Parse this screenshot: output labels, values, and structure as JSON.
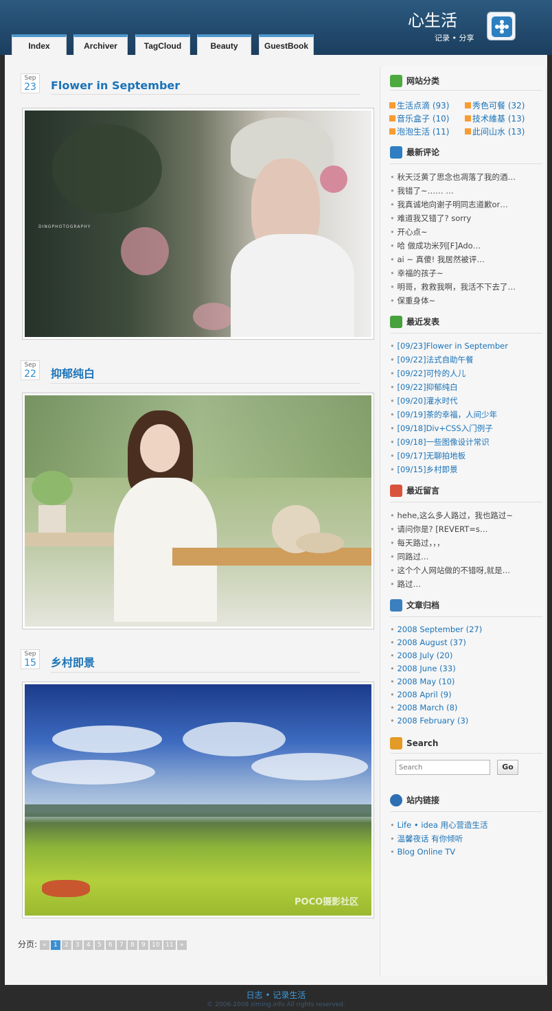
{
  "site": {
    "title": "心生活",
    "subtitle": "记录 • 分享"
  },
  "nav": {
    "tabs": [
      "Index",
      "Archiver",
      "TagCloud",
      "Beauty",
      "GuestBook"
    ]
  },
  "posts": [
    {
      "month": "Sep",
      "day": "23",
      "title": "Flower in September"
    },
    {
      "month": "Sep",
      "day": "22",
      "title": "抑郁纯白"
    },
    {
      "month": "Sep",
      "day": "15",
      "title": "乡村即景"
    }
  ],
  "photo_texts": {
    "p1_watermark": "DINGPHOTOGRAPHY",
    "p3_watermark": "POCO摄影社区"
  },
  "pager": {
    "label": "分页:",
    "prev": "«",
    "next": "»",
    "pages": [
      "1",
      "2",
      "3",
      "4",
      "5",
      "6",
      "7",
      "8",
      "9",
      "10",
      "11"
    ],
    "current": "1"
  },
  "sidebar": {
    "categories": {
      "title": "网站分类",
      "items": [
        {
          "label": "生活点滴",
          "count": "(93)"
        },
        {
          "label": "秀色可餐",
          "count": "(32)"
        },
        {
          "label": "音乐盒子",
          "count": "(10)"
        },
        {
          "label": "技术維基",
          "count": "(13)"
        },
        {
          "label": "泡泡生活",
          "count": "(11)"
        },
        {
          "label": "此间山水",
          "count": "(13)"
        }
      ]
    },
    "recent_comments": {
      "title": "最新评论",
      "items": [
        "秋天泛黄了思念也凋落了我的酒…",
        "我错了~…… …",
        "我真诚地向谢子明同志道歉or…",
        "难道我又错了? sorry",
        "开心点~",
        "哈 做成功米列[F]Ado…",
        "ai ~ 真傻! 我居然被评…",
        "幸福的孩子~",
        "明哥，救救我啊，我活不下去了…",
        "保重身体~"
      ]
    },
    "recent_posts": {
      "title": "最近发表",
      "items": [
        "[09/23]Flower in September",
        "[09/22]法式自助午餐",
        "[09/22]可怜的人儿",
        "[09/22]抑郁纯白",
        "[09/20]灌水时代",
        "[09/19]茶的幸福，人间少年",
        "[09/18]Div+CSS入门例子",
        "[09/18]一些图像设计常识",
        "[09/17]无聊拍地板",
        "[09/15]乡村即景"
      ]
    },
    "recent_messages": {
      "title": "最近留言",
      "items": [
        "hehe,这么多人路过，我也路过~",
        "请问你是? [REVERT=s…",
        "每天路过，，，",
        "同路过…",
        "这个个人网站做的不错呀,就是…",
        "路过…"
      ]
    },
    "archives": {
      "title": "文章归档",
      "items": [
        "2008 September (27)",
        "2008 August (37)",
        "2008 July (20)",
        "2008 June (33)",
        "2008 May (10)",
        "2008 April (9)",
        "2008 March (8)",
        "2008 February (3)"
      ]
    },
    "search": {
      "title": "Search",
      "placeholder": "Search",
      "button": "Go"
    },
    "links": {
      "title": "站内链接",
      "items": [
        "Life • idea 用心营造生活",
        "温馨夜话 有你倾听",
        "Blog Online TV"
      ]
    }
  },
  "footer": {
    "line1": "日志 • 记录生活",
    "line2": "© 2006-2008 ziming.info All rights reserved."
  },
  "colors": {
    "header": "#1b3e5e",
    "link": "#1a73b8",
    "tab_accent": "#4d97cc"
  },
  "icons": [
    "site-logo-icon",
    "folder-icon",
    "comment-icon",
    "document-icon",
    "edit-icon",
    "chart-icon",
    "search-icon",
    "globe-icon",
    "rss-icon"
  ]
}
